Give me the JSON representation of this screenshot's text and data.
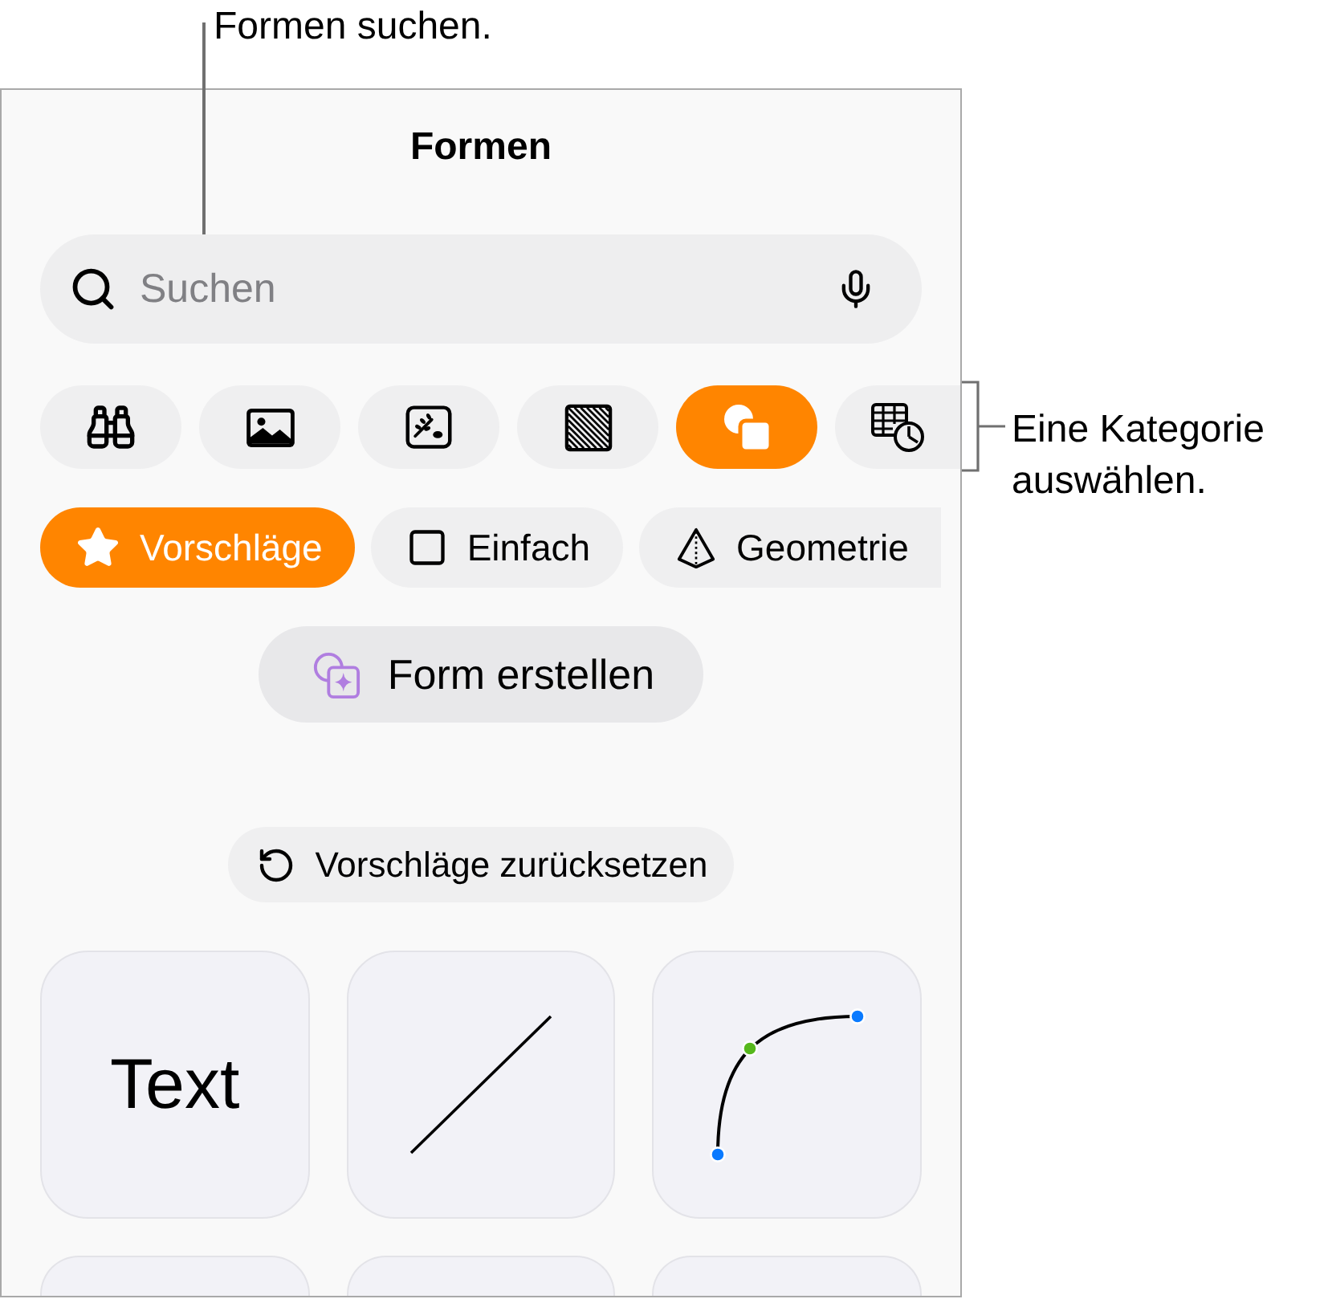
{
  "callouts": {
    "search": "Formen suchen.",
    "category": "Eine Kategorie auswählen."
  },
  "title": "Formen",
  "search": {
    "placeholder": "Suchen"
  },
  "categories": [
    {
      "kind": "binoculars",
      "selected": false
    },
    {
      "kind": "photo",
      "selected": false
    },
    {
      "kind": "illustration",
      "selected": false
    },
    {
      "kind": "pattern",
      "selected": false
    },
    {
      "kind": "shapes",
      "selected": true
    },
    {
      "kind": "table",
      "selected": false
    }
  ],
  "filters": [
    {
      "kind": "star",
      "label": "Vorschläge",
      "selected": true
    },
    {
      "kind": "square",
      "label": "Einfach",
      "selected": false
    },
    {
      "kind": "pyramid",
      "label": "Geometrie",
      "selected": false
    }
  ],
  "create_button": {
    "label": "Form erstellen"
  },
  "reset_button": {
    "label": "Vorschläge zurücksetzen"
  },
  "tiles": [
    {
      "kind": "text",
      "label": "Text"
    },
    {
      "kind": "line"
    },
    {
      "kind": "curve"
    },
    {
      "kind": "blank"
    },
    {
      "kind": "blank"
    },
    {
      "kind": "blank"
    }
  ]
}
